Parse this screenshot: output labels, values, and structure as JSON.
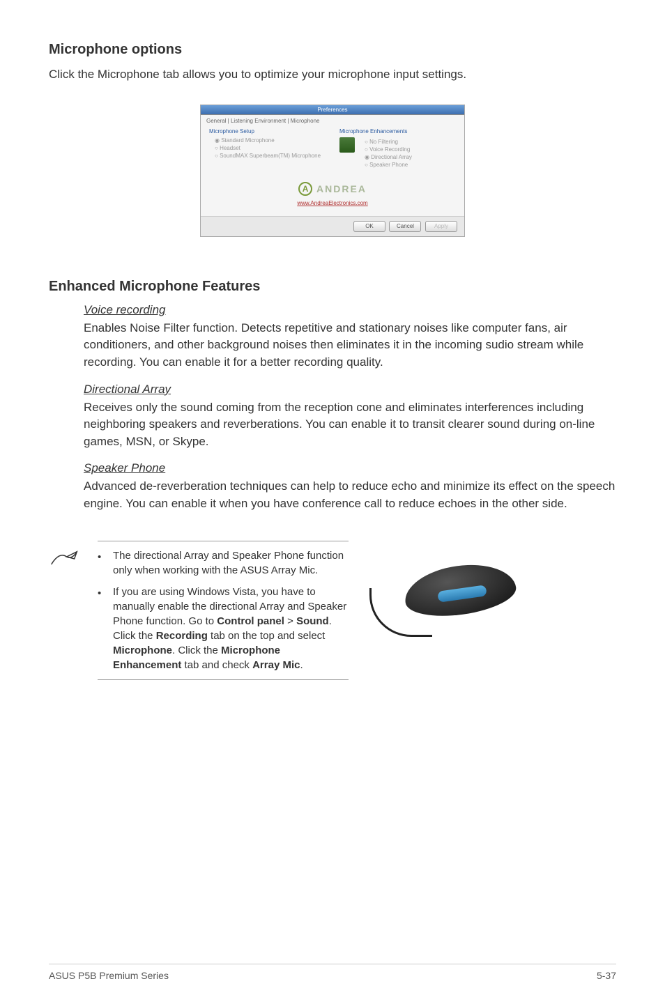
{
  "section1": {
    "heading": "Microphone options",
    "body": "Click the Microphone tab allows you to optimize your microphone input settings."
  },
  "screenshot": {
    "titlebar": "Preferences",
    "tabs": "General | Listening Environment | Microphone",
    "left_label": "Microphone Setup",
    "left_opts": {
      "o1": "Standard Microphone",
      "o2": "Headset",
      "o3": "SoundMAX Superbeam(TM) Microphone"
    },
    "right_label": "Microphone Enhancements",
    "right_opts": {
      "o1": "No Filtering",
      "o2": "Voice Recording",
      "o3": "Directional Array",
      "o4": "Speaker Phone"
    },
    "andrea_logo_letter": "A",
    "andrea_text": "ANDREA",
    "andrea_link": "www.AndreaElectronics.com",
    "btn_ok": "OK",
    "btn_cancel": "Cancel",
    "btn_apply": "Apply"
  },
  "section2": {
    "heading": "Enhanced Microphone Features",
    "sub1_title": "Voice recording",
    "sub1_body": "Enables Noise Filter function. Detects repetitive and stationary noises like computer fans, air conditioners, and other background noises then eliminates it in the incoming sudio stream while recording. You can enable it for a better recording quality.",
    "sub2_title": "Directional Array",
    "sub2_body": "Receives only the sound coming from the reception cone and eliminates interferences including neighboring speakers and reverberations. You can enable it to transit clearer sound during on-line games, MSN, or Skype.",
    "sub3_title": "Speaker Phone",
    "sub3_body": "Advanced de-reverberation techniques can help to reduce echo and minimize its effect on the speech engine. You can enable it when you have conference call to reduce echoes in the other side."
  },
  "notes": {
    "n1": "The directional Array and Speaker Phone function only when working with the ASUS Array Mic.",
    "n2_pre": "If you are using Windows Vista, you have to manually enable the directional Array and Speaker Phone function. Go to ",
    "n2_b1": "Control panel",
    "n2_gt1": " > ",
    "n2_b2": "Sound",
    "n2_mid1": ". Click the ",
    "n2_b3": "Recording",
    "n2_mid2": " tab on the top and select ",
    "n2_b4": "Microphone",
    "n2_mid3": ". Click the ",
    "n2_b5": "Microphone Enhancement",
    "n2_mid4": " tab and check ",
    "n2_b6": "Array Mic",
    "n2_end": "."
  },
  "footer": {
    "left": "ASUS P5B Premium Series",
    "right": "5-37"
  }
}
